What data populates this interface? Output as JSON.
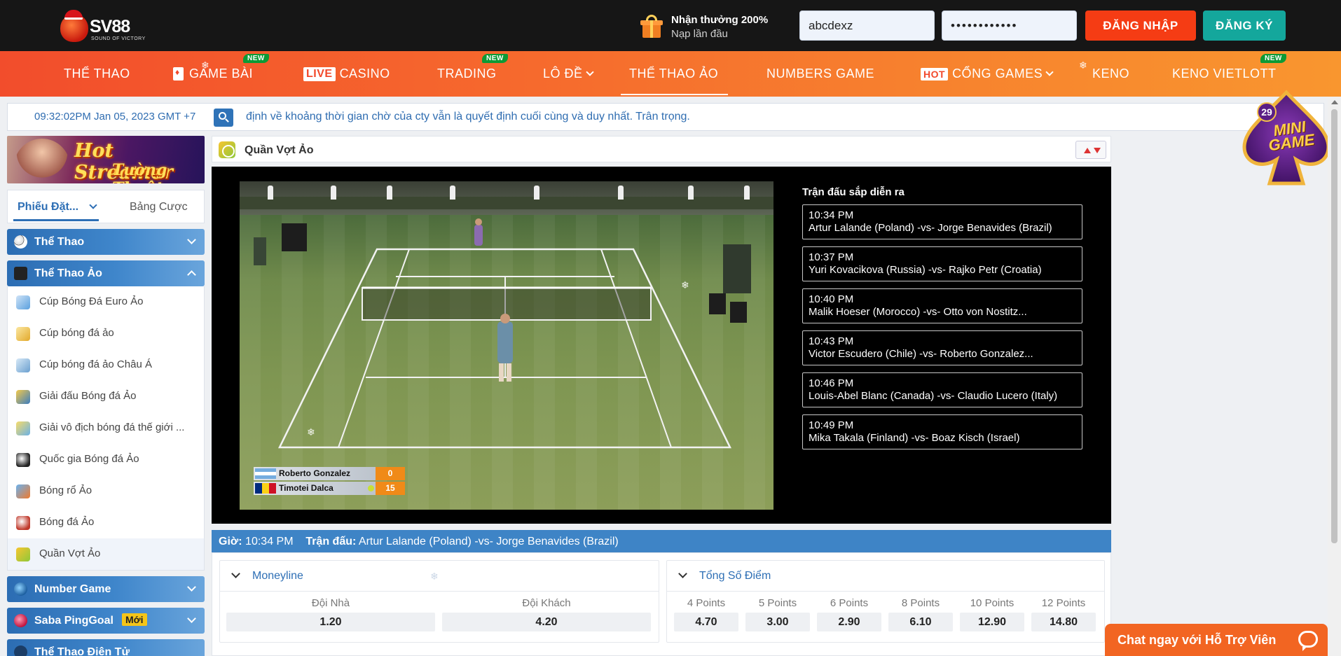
{
  "header": {
    "logo_text": "SV88",
    "logo_tagline": "SOUND OF VICTORY",
    "promo_line1": "Nhận thưởng 200%",
    "promo_line2": "Nạp lần đầu",
    "username_value": "abcdexz",
    "password_value": "••••••••••••",
    "login_label": "ĐĂNG NHẬP",
    "register_label": "ĐĂNG KÝ"
  },
  "nav": {
    "items": [
      {
        "label": "THỂ THAO"
      },
      {
        "label": "GAME BÀI",
        "badge": "NEW"
      },
      {
        "prefix": "LIVE",
        "label": "CASINO"
      },
      {
        "label": "TRADING",
        "badge": "NEW"
      },
      {
        "label": "LÔ ĐỀ"
      },
      {
        "label": "THỂ THAO ẢO"
      },
      {
        "label": "NUMBERS GAME"
      },
      {
        "prefix": "HOT",
        "label": "CỔNG GAMES"
      },
      {
        "label": "KENO"
      },
      {
        "label": "KENO VIETLOTT",
        "badge": "NEW"
      }
    ]
  },
  "infobar": {
    "clock": "09:32:02PM Jan 05, 2023 GMT +7",
    "marquee": "định về khoảng thời gian chờ của cty vẫn là quyết định cuối cùng và duy nhất. Trân trọng."
  },
  "sidebar": {
    "banner_line1": "Hot Streamer",
    "banner_line2": "Tường Thuật",
    "tab_slip": "Phiếu Đặt...",
    "tab_bets": "Bảng Cược",
    "sections": [
      {
        "label": "Thể Thao"
      },
      {
        "label": "Thể Thao Ảo"
      },
      {
        "label": "Number Game"
      },
      {
        "label": "Saba PingGoal",
        "tag": "Mới"
      },
      {
        "label": "Thể Thao Điện Tử"
      }
    ],
    "virtual_items": [
      {
        "label": "Cúp Bóng Đá Euro Ảo",
        "icon": "trophy-icon"
      },
      {
        "label": "Cúp bóng đá ảo",
        "icon": "trophy-icon"
      },
      {
        "label": "Cúp bóng đá ảo Châu Á",
        "icon": "trophy-icon"
      },
      {
        "label": "Giải đấu Bóng đá Ảo",
        "icon": "soccer-icon"
      },
      {
        "label": "Giải vô địch bóng đá thế giới ...",
        "icon": "trophy-icon"
      },
      {
        "label": "Quốc gia Bóng đá Ảo",
        "icon": "soccer-icon"
      },
      {
        "label": "Bóng rổ Ảo",
        "icon": "basketball-icon"
      },
      {
        "label": "Bóng đá Ảo",
        "icon": "soccer-icon"
      },
      {
        "label": "Quần Vợt Ảo",
        "icon": "tennis-icon"
      }
    ]
  },
  "main": {
    "title": "Quần Vợt Ảo",
    "scoreboard": [
      {
        "name": "Roberto Gonzalez",
        "score": "0"
      },
      {
        "name": "Timotei Dalca",
        "score": "15"
      }
    ],
    "upcoming_title": "Trận đấu sắp diễn ra",
    "upcoming": [
      {
        "time": "10:34 PM",
        "match": "Artur Lalande (Poland) -vs- Jorge Benavides (Brazil)"
      },
      {
        "time": "10:37 PM",
        "match": "Yuri Kovacikova (Russia) -vs- Rajko Petr (Croatia)"
      },
      {
        "time": "10:40 PM",
        "match": "Malik Hoeser (Morocco) -vs- Otto von Nostitz..."
      },
      {
        "time": "10:43 PM",
        "match": "Victor Escudero (Chile) -vs- Roberto Gonzalez..."
      },
      {
        "time": "10:46 PM",
        "match": "Louis-Abel Blanc (Canada) -vs- Claudio Lucero (Italy)"
      },
      {
        "time": "10:49 PM",
        "match": "Mika Takala (Finland) -vs- Boaz Kisch (Israel)"
      }
    ],
    "match_bar": {
      "time_label": "Giờ:",
      "time_value": "10:34 PM",
      "match_label": "Trận đấu:",
      "match_value": "Artur Lalande (Poland) -vs- Jorge Benavides (Brazil)"
    },
    "moneyline": {
      "title": "Moneyline",
      "options": [
        {
          "label": "Đội Nhà",
          "odds": "1.20"
        },
        {
          "label": "Đội Khách",
          "odds": "4.20"
        }
      ]
    },
    "total_points": {
      "title": "Tổng Số Điểm",
      "options": [
        {
          "label": "4 Points",
          "odds": "4.70"
        },
        {
          "label": "5 Points",
          "odds": "3.00"
        },
        {
          "label": "6 Points",
          "odds": "2.90"
        },
        {
          "label": "8 Points",
          "odds": "6.10"
        },
        {
          "label": "10 Points",
          "odds": "12.90"
        },
        {
          "label": "12 Points",
          "odds": "14.80"
        }
      ]
    }
  },
  "floating": {
    "minigame_count": "29",
    "minigame_label": "MINI GAME",
    "chat_label": "Chat ngay với Hỗ Trợ Viên"
  },
  "colors": {
    "login": "#f53c14",
    "register": "#14a79c",
    "nav_start": "#f24d2c",
    "nav_end": "#f9962f",
    "section_blue": "#2c6db3",
    "match_bar": "#3e84c6"
  }
}
